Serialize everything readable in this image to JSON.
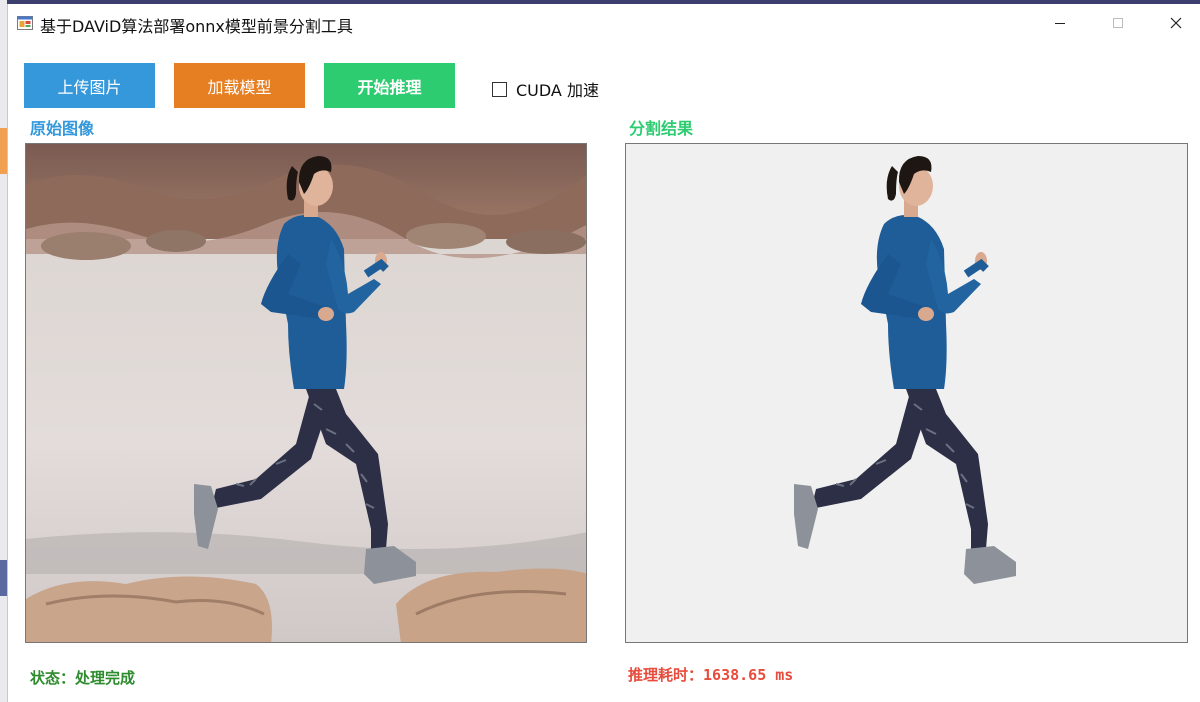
{
  "window": {
    "title": "基于DAViD算法部署onnx模型前景分割工具",
    "icon": "app-window-icon",
    "controls": {
      "minimize": "minimize-icon",
      "maximize": "maximize-icon",
      "close": "close-icon"
    }
  },
  "toolbar": {
    "upload_label": "上传图片",
    "load_label": "加载模型",
    "run_label": "开始推理",
    "cuda_label": "CUDA 加速",
    "cuda_checked": false
  },
  "panels": {
    "original_label": "原始图像",
    "result_label": "分割结果"
  },
  "footer": {
    "status_text": "状态：处理完成",
    "timing_label": "推理耗时：",
    "timing_value": "1638.65 ms"
  },
  "colors": {
    "upload": "#3498db",
    "load": "#e67e22",
    "run": "#2ecc71",
    "status": "#2e8b2e",
    "timing": "#e74c3c",
    "result_bg": "#f0f0f0"
  }
}
